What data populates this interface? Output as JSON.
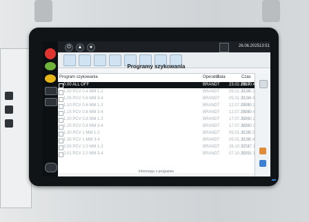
{
  "topbar": {
    "date": "26.06.2025",
    "time": "13:51"
  },
  "title": "Programy szykowania",
  "table": {
    "columns": {
      "name": "Program szykowania",
      "operator": "Operator",
      "date": "Data",
      "czas": "Czas"
    },
    "rows": [
      {
        "name": "0.00  ALL OFF",
        "operator": "BRANDT",
        "date": "23.02.2017",
        "time": "08:00:48",
        "selected": true
      },
      {
        "name": "1.00  PCV 0.4 MM 1-2",
        "operator": "BRANDT",
        "date": "05.01.2024",
        "time": "11:15:11",
        "selected": false
      },
      {
        "name": "1.05  PCV 0.6 MM 3-4",
        "operator": "BRANDT",
        "date": "05.01.2024",
        "time": "11:14:46",
        "selected": false
      },
      {
        "name": "1.10  PCV 0.6 MM 1-2",
        "operator": "BRANDT",
        "date": "12.07.2024",
        "time": "09:59:25",
        "selected": false
      },
      {
        "name": "1.15  PCV 0.6 MM 3-4",
        "operator": "BRANDT",
        "date": "12.07.2024",
        "time": "09:59:41",
        "selected": false
      },
      {
        "name": "1.20  PCV 0.8 MM 1-2",
        "operator": "BRANDT",
        "date": "17.07.2024",
        "time": "10:00:20",
        "selected": false
      },
      {
        "name": "1.25  PCV 0.8 MM 3-4",
        "operator": "BRANDT",
        "date": "17.07.2024",
        "time": "10:00:36",
        "selected": false
      },
      {
        "name": "1.30  PCV 1 MM 1-2",
        "operator": "BRANDT",
        "date": "05.01.2024",
        "time": "11:15:35",
        "selected": false
      },
      {
        "name": "1.35  PCV 1 MM 3-4",
        "operator": "BRANDT",
        "date": "05.01.2024",
        "time": "11:15:47",
        "selected": false
      },
      {
        "name": "2.00  PCV 2.0 MM 1-2",
        "operator": "BRANDT",
        "date": "26.10.2022",
        "time": "17:47:16",
        "selected": false
      },
      {
        "name": "2.01  PCV 2.0 MM 3-4",
        "operator": "BRANDT",
        "date": "07.10.2022",
        "time": "13:51:19",
        "selected": false
      }
    ]
  },
  "footer": "Informacje o programie",
  "icons": {
    "lefttool": [
      "alarm-icon",
      "green-status-icon",
      "yellow-status-icon",
      "stack-icon",
      "tool-icon",
      "tray-icon"
    ],
    "topbar": [
      "power-icon",
      "warning-icon",
      "user-icon"
    ],
    "iconrow": [
      "folder-icon",
      "copy-icon",
      "new-icon",
      "edit-icon",
      "delete-icon",
      "upload-icon",
      "download-icon",
      "save-icon"
    ],
    "rightpane": [
      "info-icon",
      "help-icon",
      "list-icon"
    ]
  }
}
